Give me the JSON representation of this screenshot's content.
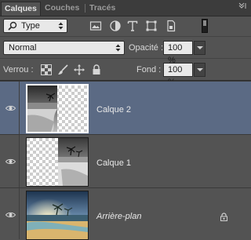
{
  "tabs": [
    {
      "label": "Calques",
      "active": true
    },
    {
      "label": "Couches",
      "active": false
    },
    {
      "label": "Tracés",
      "active": false
    }
  ],
  "filter": {
    "kind_label": "Type",
    "icons": [
      "image-filter-icon",
      "adjustment-filter-icon",
      "type-filter-icon",
      "shape-filter-icon",
      "smart-object-filter-icon"
    ]
  },
  "blend": {
    "mode": "Normal",
    "opacity_label": "Opacité :",
    "opacity_value": "100 %"
  },
  "lock": {
    "label": "Verrou :",
    "icons": [
      "lock-transparent-pixels-icon",
      "lock-image-pixels-icon",
      "lock-position-icon",
      "lock-all-icon"
    ],
    "fill_label": "Fond :",
    "fill_value": "100 %"
  },
  "layers": [
    {
      "name": "Calque 2",
      "selected": true,
      "visible": true,
      "locked": false
    },
    {
      "name": "Calque 1",
      "selected": false,
      "visible": true,
      "locked": false
    },
    {
      "name": "Arrière-plan",
      "selected": false,
      "visible": true,
      "locked": true
    }
  ],
  "colors": {
    "panel_bg": "#535353",
    "selected_row": "#5b6a84",
    "tab_bar": "#3c3c3c"
  }
}
